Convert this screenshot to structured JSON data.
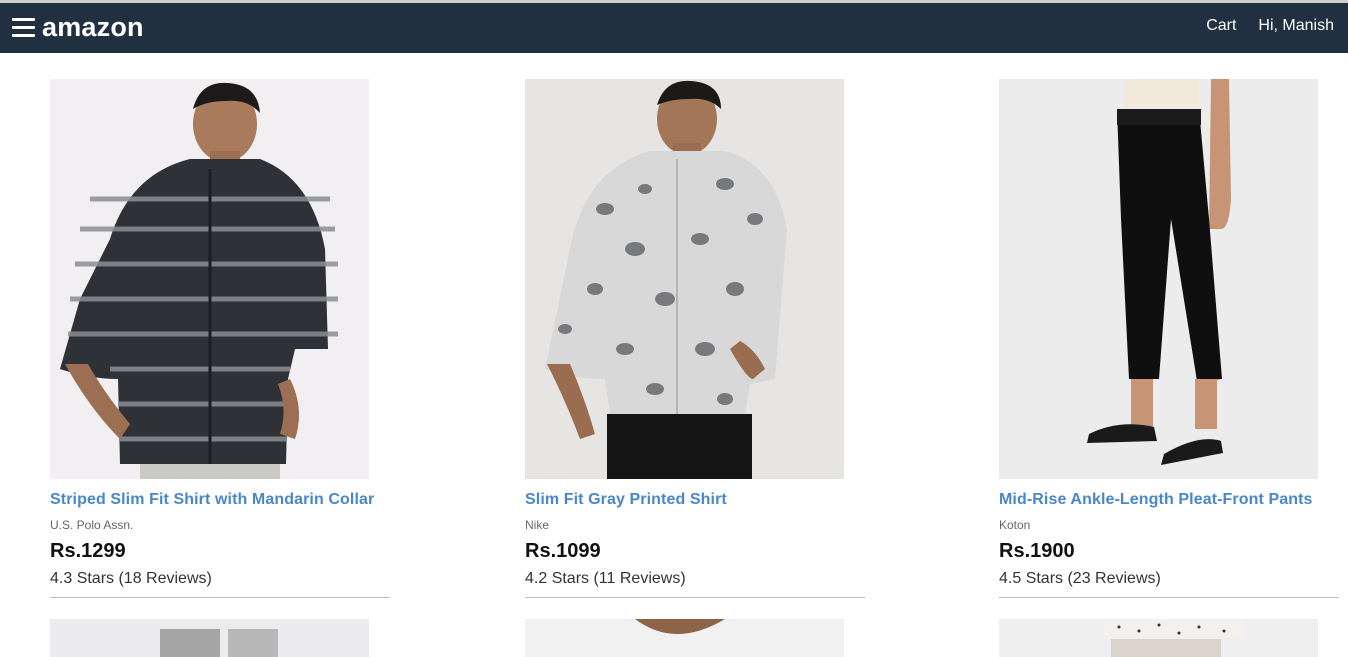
{
  "header": {
    "logo": "amazon",
    "cart_label": "Cart",
    "user_greeting": "Hi, Manish"
  },
  "products": [
    {
      "title": "Striped Slim Fit Shirt with Mandarin Collar",
      "brand": "U.S. Polo Assn.",
      "price": "Rs.1299",
      "rating": "4.3 Stars (18 Reviews)"
    },
    {
      "title": "Slim Fit Gray Printed Shirt",
      "brand": "Nike",
      "price": "Rs.1099",
      "rating": "4.2 Stars (11 Reviews)"
    },
    {
      "title": "Mid-Rise Ankle-Length Pleat-Front Pants",
      "brand": "Koton",
      "price": "Rs.1900",
      "rating": "4.5 Stars (23 Reviews)"
    }
  ],
  "colors": {
    "header_bg": "#203040",
    "title_link": "#4a87c9"
  }
}
